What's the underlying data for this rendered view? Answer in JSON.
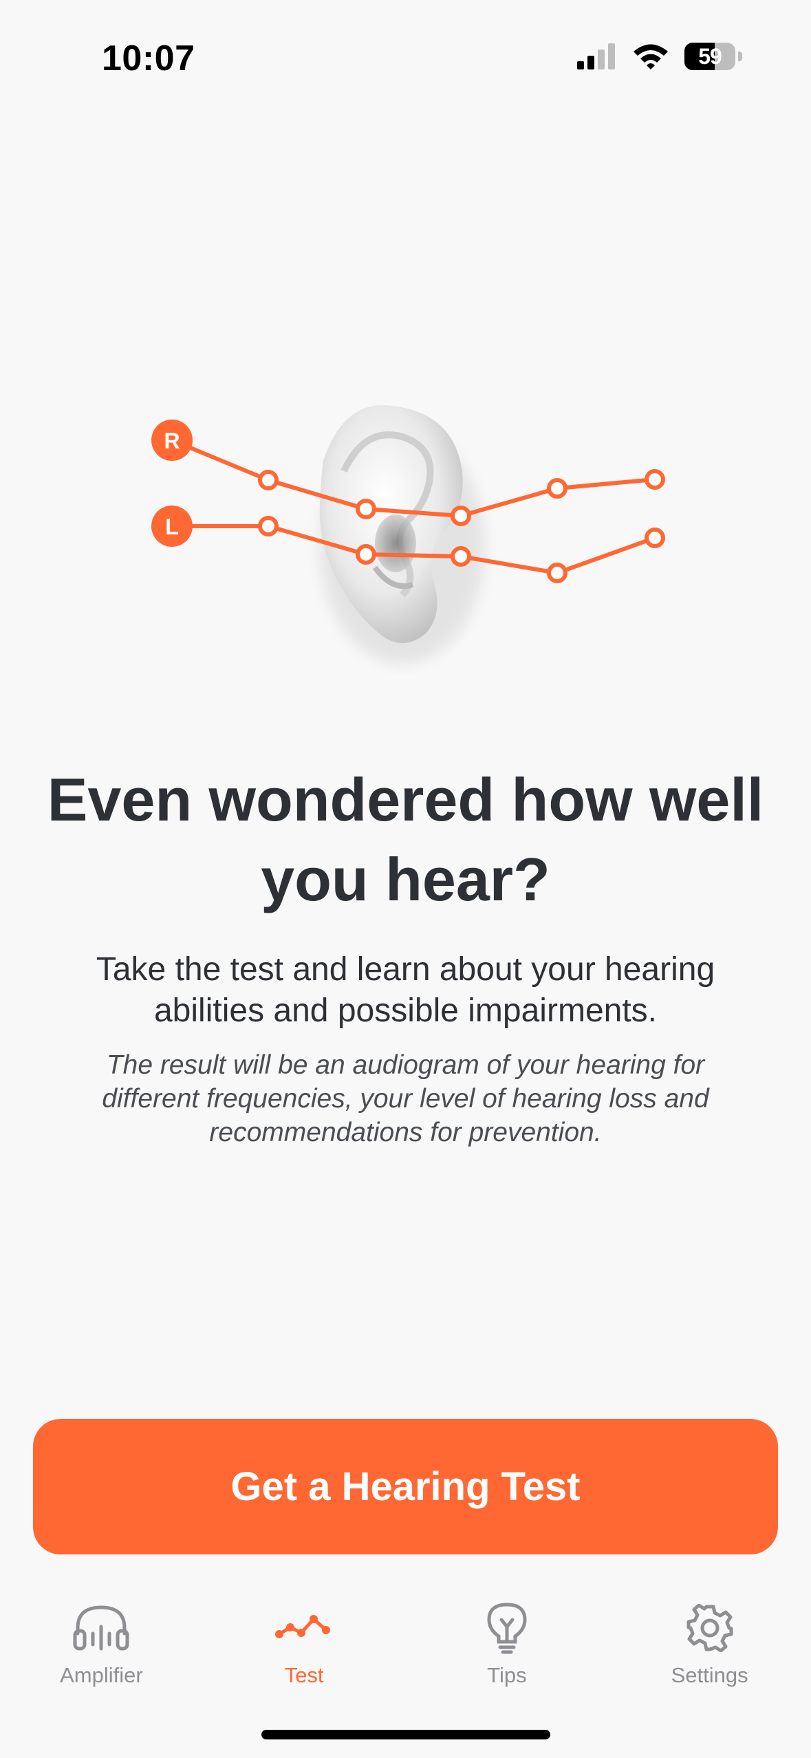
{
  "status_bar": {
    "time": "10:07",
    "battery_level": "59",
    "icons": [
      "cellular-signal-icon",
      "wifi-icon",
      "battery-icon"
    ]
  },
  "illustration": {
    "right_marker": "R",
    "left_marker": "L",
    "icons": [
      "ear-icon",
      "audiogram-lines-icon"
    ]
  },
  "main": {
    "headline": "Even wondered how well you hear?",
    "subtitle": "Take the test and learn about your hearing abilities and possible impairments.",
    "note": "The result will be an audiogram of your hearing for different frequencies, your level of hearing loss and recommendations for prevention."
  },
  "cta": {
    "label": "Get a Hearing Test"
  },
  "tab_bar": {
    "active_tab": "Test",
    "tabs": [
      {
        "label": "Amplifier",
        "icon": "headphones-icon"
      },
      {
        "label": "Test",
        "icon": "test-graph-icon"
      },
      {
        "label": "Tips",
        "icon": "lightbulb-icon"
      },
      {
        "label": "Settings",
        "icon": "gear-icon"
      }
    ]
  },
  "colors": {
    "accent": "#ff6833",
    "background": "#f8f8f8",
    "text_primary": "#2d3035",
    "tab_inactive": "#8e8e93"
  }
}
